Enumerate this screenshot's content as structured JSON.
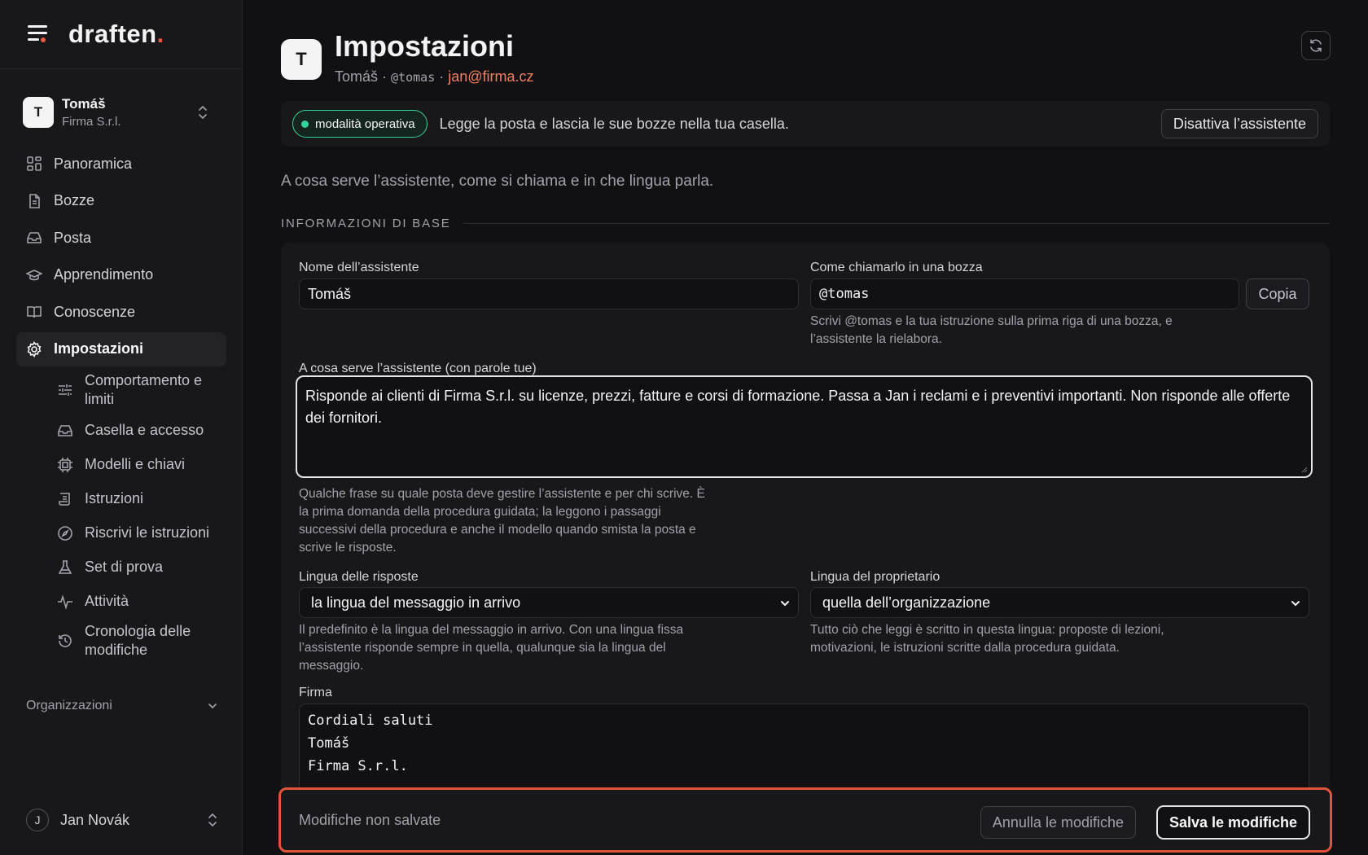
{
  "app": {
    "logo_text": "draften",
    "logo_dot": ".",
    "accent": "#ef5a3c"
  },
  "account": {
    "initial": "T",
    "name": "Tomáš",
    "org": "Firma S.r.l."
  },
  "nav": {
    "items": [
      {
        "label": "Panoramica",
        "icon": "grid-icon"
      },
      {
        "label": "Bozze",
        "icon": "document-icon"
      },
      {
        "label": "Posta",
        "icon": "inbox-icon"
      },
      {
        "label": "Apprendimento",
        "icon": "graduation-cap-icon"
      },
      {
        "label": "Conoscenze",
        "icon": "book-icon"
      },
      {
        "label": "Impostazioni",
        "icon": "gear-icon",
        "active": true
      }
    ],
    "sub_items": [
      {
        "label": "Comportamento e limiti",
        "icon": "sliders-icon"
      },
      {
        "label": "Casella e accesso",
        "icon": "inbox-icon"
      },
      {
        "label": "Modelli e chiavi",
        "icon": "chip-icon"
      },
      {
        "label": "Istruzioni",
        "icon": "scroll-icon"
      },
      {
        "label": "Riscrivi le istruzioni",
        "icon": "compass-icon"
      },
      {
        "label": "Set di prova",
        "icon": "flask-icon"
      },
      {
        "label": "Attività",
        "icon": "activity-icon"
      },
      {
        "label": "Cronologia delle modifiche",
        "icon": "history-icon"
      }
    ],
    "orgs_label": "Organizzazioni"
  },
  "user": {
    "initial": "J",
    "name": "Jan Novák"
  },
  "page": {
    "initial": "T",
    "title": "Impostazioni",
    "sub_name": "Tomáš",
    "sep": "·",
    "handle": "@tomas",
    "email": "jan@firma.cz"
  },
  "status": {
    "badge": "modalità operativa",
    "text": "Legge la posta e lascia le sue bozze nella tua casella.",
    "deactivate": "Disattiva l’assistente",
    "badge_color": "#34d399"
  },
  "intro": "A cosa serve l’assistente, come si chiama e in che lingua parla.",
  "section_title": "INFORMAZIONI DI BASE",
  "form": {
    "name_label": "Nome dell’assistente",
    "name_value": "Tomáš",
    "mention_label": "Come chiamarlo in una bozza",
    "mention_value": "@tomas",
    "copy_label": "Copia",
    "mention_hint": "Scrivi @tomas e la tua istruzione sulla prima riga di una bozza, e l’assistente la rielabora.",
    "purpose_label": "A cosa serve l’assistente (con parole tue)",
    "purpose_value": "Risponde ai clienti di Firma S.r.l. su licenze, prezzi, fatture e corsi di formazione. Passa a Jan i reclami e i preventivi importanti. Non risponde alle offerte dei fornitori.",
    "purpose_hint": "Qualche frase su quale posta deve gestire l’assistente e per chi scrive. È la prima domanda della procedura guidata; la leggono i passaggi successivi della procedura e anche il modello quando smista la posta e scrive le risposte.",
    "reply_lang_label": "Lingua delle risposte",
    "reply_lang_value": "la lingua del messaggio in arrivo",
    "reply_lang_hint": "Il predefinito è la lingua del messaggio in arrivo. Con una lingua fissa l’assistente risponde sempre in quella, qualunque sia la lingua del messaggio.",
    "owner_lang_label": "Lingua del proprietario",
    "owner_lang_value": "quella dell’organizzazione",
    "owner_lang_hint": "Tutto ciò che leggi è scritto in questa lingua: proposte di lezioni, motivazioni, le istruzioni scritte dalla procedura guidata.",
    "signature_label": "Firma",
    "signature_lines": [
      "Cordiali saluti",
      "Tomáš",
      "Firma S.r.l."
    ]
  },
  "save_bar": {
    "text": "Modifiche non salvate",
    "cancel": "Annulla le modifiche",
    "save": "Salva le modifiche",
    "border_color": "#e0553a"
  }
}
